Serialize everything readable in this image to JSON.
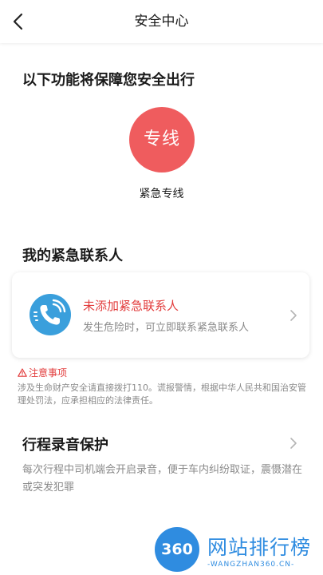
{
  "header": {
    "title": "安全中心",
    "back_icon": "chevron-left-icon"
  },
  "features": {
    "title": "以下功能将保障您安全出行",
    "hotline": {
      "circle_text": "专线",
      "label": "紧急专线",
      "color": "#ef5c5e"
    }
  },
  "contacts": {
    "title": "我的紧急联系人",
    "card": {
      "icon": "phone-icon",
      "title": "未添加紧急联系人",
      "description": "发生危险时，可立即联系紧急联系人"
    }
  },
  "notice": {
    "title": "注意事项",
    "icon": "warning-triangle-icon",
    "text": "涉及生命财产安全请直接拨打110。谎报警情，根据中华人民共和国治安管理处罚法，应承担相应的法律责任。"
  },
  "recording": {
    "title": "行程录音保护",
    "description": "每次行程中司机端会开启录音，便于车内纠纷取证，震慑潜在或突发犯罪"
  },
  "watermark": {
    "logo": "360",
    "name": "网站排行榜",
    "url": "-WANGZHAN360.CN-"
  },
  "colors": {
    "accent_red": "#e23c3c",
    "phone_blue": "#3a9fdc",
    "watermark_blue": "#2f8ce0"
  }
}
